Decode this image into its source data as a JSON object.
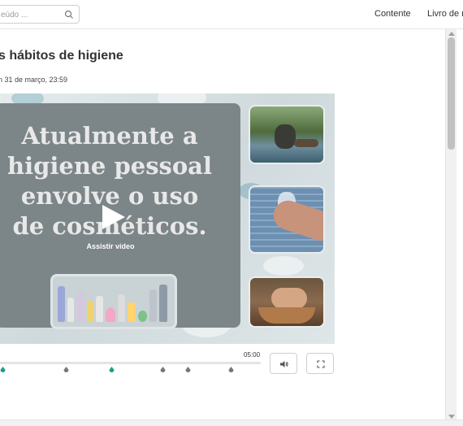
{
  "header": {
    "search": {
      "placeholder": "eúdo ...",
      "icon": "search-icon"
    },
    "nav": [
      {
        "label": "Contente"
      },
      {
        "label": "Livro de n"
      }
    ]
  },
  "content": {
    "title": "s hábitos de higiene",
    "date": "n 31 de março, 23:59"
  },
  "video": {
    "slide_lines": [
      "Atualmente a",
      "higiene pessoal",
      "envolve o uso",
      "de cosméticos."
    ],
    "play_label": "Assistir vídeo",
    "duration": "05:00",
    "progress": 0,
    "marker_colors": [
      "#1a9e86",
      "#777777",
      "#1a9e86",
      "#777777",
      "#777777",
      "#777777"
    ],
    "controls": {
      "volume_icon": "volume-icon",
      "fullscreen_icon": "fullscreen-icon"
    }
  },
  "colors": {
    "accent": "#1a9e86",
    "marker_neutral": "#777777"
  }
}
